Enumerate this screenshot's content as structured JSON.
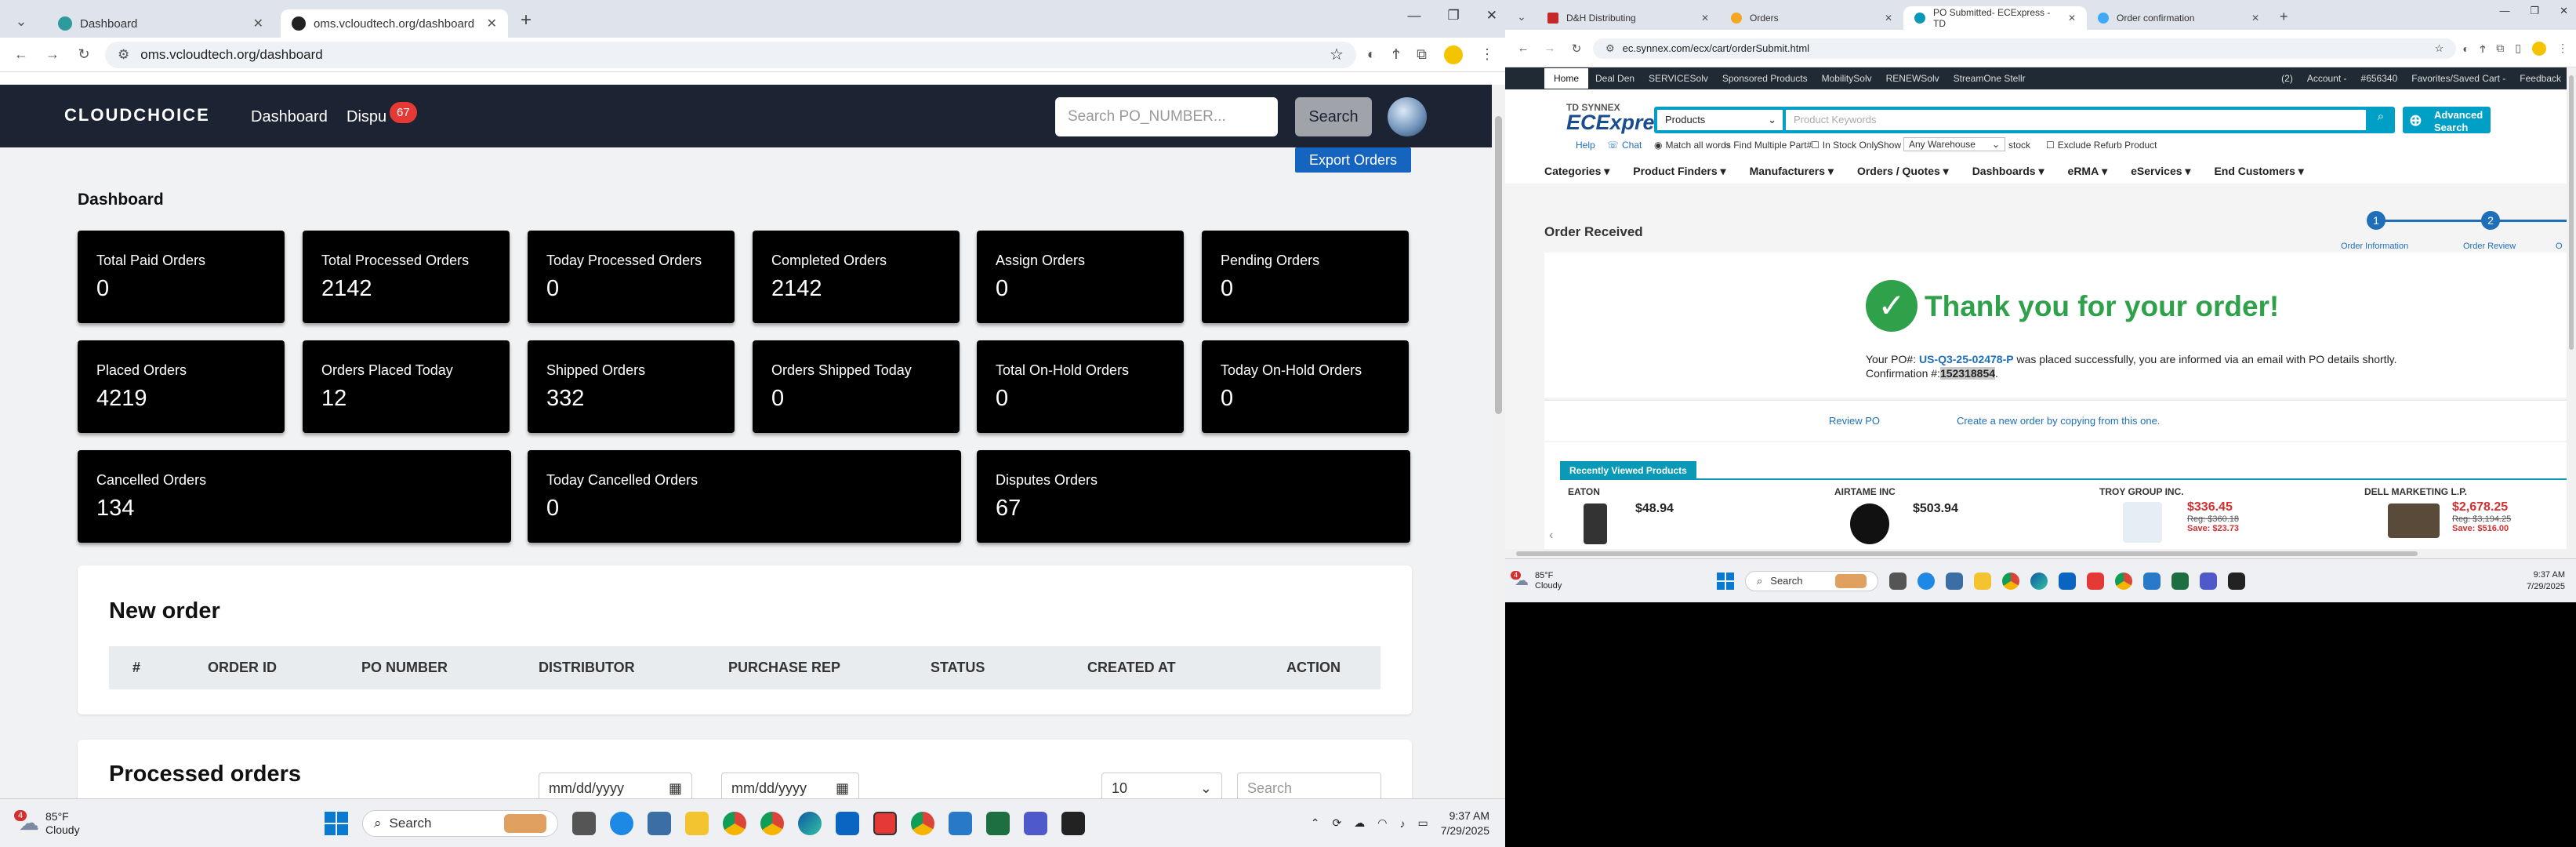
{
  "left": {
    "tabs": [
      {
        "label": "Dashboard",
        "favicon_color": "#2d9a9c"
      },
      {
        "label": "oms.vcloudtech.org/dashboard",
        "favicon_color": "#222222"
      }
    ],
    "address": "oms.vcloudtech.org/dashboard",
    "nav": {
      "logo": "CLOUDCHOICE",
      "dashboard": "Dashboard",
      "disputes": "Dispu",
      "disputes_badge": "67",
      "search_placeholder": "Search PO_NUMBER...",
      "search_button": "Search"
    },
    "export_button": "Export Orders",
    "dashboard_title": "Dashboard",
    "cards": [
      {
        "label": "Total Paid Orders",
        "value": "0"
      },
      {
        "label": "Total Processed Orders",
        "value": "2142"
      },
      {
        "label": "Today Processed Orders",
        "value": "0"
      },
      {
        "label": "Completed Orders",
        "value": "2142"
      },
      {
        "label": "Assign Orders",
        "value": "0"
      },
      {
        "label": "Pending Orders",
        "value": "0"
      },
      {
        "label": "Placed Orders",
        "value": "4219"
      },
      {
        "label": "Orders Placed Today",
        "value": "12"
      },
      {
        "label": "Shipped Orders",
        "value": "332"
      },
      {
        "label": "Orders Shipped Today",
        "value": "0"
      },
      {
        "label": "Total On-Hold Orders",
        "value": "0"
      },
      {
        "label": "Today On-Hold Orders",
        "value": "0"
      },
      {
        "label": "Cancelled Orders",
        "value": "134"
      },
      {
        "label": "Today Cancelled Orders",
        "value": "0"
      },
      {
        "label": "Disputes Orders",
        "value": "67"
      }
    ],
    "new_order": {
      "title": "New order",
      "columns": [
        "#",
        "ORDER ID",
        "PO NUMBER",
        "DISTRIBUTOR",
        "PURCHASE REP",
        "STATUS",
        "CREATED AT",
        "ACTION"
      ]
    },
    "processed": {
      "title": "Processed orders",
      "date_placeholder": "mm/dd/yyyy",
      "page_size": "10",
      "search_placeholder": "Search"
    },
    "taskbar": {
      "weather_temp": "85°F",
      "weather_cond": "Cloudy",
      "weather_badge": "4",
      "search": "Search",
      "time": "9:37 AM",
      "date": "7/29/2025"
    }
  },
  "right": {
    "tabs": [
      {
        "label": "D&H Distributing",
        "favicon_color": "#c62828"
      },
      {
        "label": "Orders",
        "favicon_color": "#f5a623"
      },
      {
        "label": "PO Submitted- ECExpress - TD",
        "favicon_color": "#0a9ab8"
      },
      {
        "label": "Order confirmation",
        "favicon_color": "#3fa9f5"
      }
    ],
    "address": "ec.synnex.com/ecx/cart/orderSubmit.html",
    "topnav": [
      "Home",
      "Deal Den",
      "SERVICESolv",
      "Sponsored Products",
      "MobilitySolv",
      "RENEWSolv",
      "StreamOne Stellr"
    ],
    "topnav_right": [
      "(2)",
      "Account -",
      "#656340",
      "Favorites/Saved Cart -",
      "Feedback"
    ],
    "brand_small": "TD SYNNEX",
    "brand_big": "ECExpress",
    "search_category": "Products",
    "search_placeholder": "Product Keywords",
    "advanced_search": "Advanced Search",
    "options": {
      "help": "Help",
      "chat": "Chat",
      "match_all": "Match all words",
      "find_multiple": "Find Multiple Part#",
      "in_stock": "In Stock Only",
      "show": "Show",
      "warehouse": "Any Warehouse",
      "stock": "stock",
      "exclude_refurb": "Exclude Refurb Product"
    },
    "menu": [
      "Categories",
      "Product Finders",
      "Manufacturers",
      "Orders / Quotes",
      "Dashboards",
      "eRMA",
      "eServices",
      "End Customers"
    ],
    "order_received": "Order Received",
    "steps": [
      {
        "num": "1",
        "label": "Order Information"
      },
      {
        "num": "2",
        "label": "Order Review"
      },
      {
        "num": "",
        "label": "O"
      }
    ],
    "thank_you": "Thank you for your order!",
    "po_pre": "Your PO#:",
    "po_number": "US-Q3-25-02478-P",
    "po_mid": "was placed successfully, you are informed via an email with PO details shortly. Confirmation #:",
    "confirmation": "152318854",
    "review_po": "Review PO",
    "create_new": "Create a new order by copying from this one.",
    "recently_viewed": "Recently Viewed Products",
    "products": [
      {
        "mfr": "EATON",
        "price": "$48.94",
        "reg": "",
        "save": ""
      },
      {
        "mfr": "AIRTAME INC",
        "price": "$503.94",
        "reg": "",
        "save": ""
      },
      {
        "mfr": "TROY GROUP INC.",
        "price": "$336.45",
        "reg": "Reg: $360.18",
        "save": "Save: $23.73"
      },
      {
        "mfr": "DELL MARKETING L.P.",
        "price": "$2,678.25",
        "reg": "Reg: $3,194.25",
        "save": "Save: $516.00"
      }
    ],
    "taskbar": {
      "weather_temp": "85°F",
      "weather_cond": "Cloudy",
      "weather_badge": "4",
      "search": "Search",
      "time": "9:37 AM",
      "date": "7/29/2025"
    }
  }
}
